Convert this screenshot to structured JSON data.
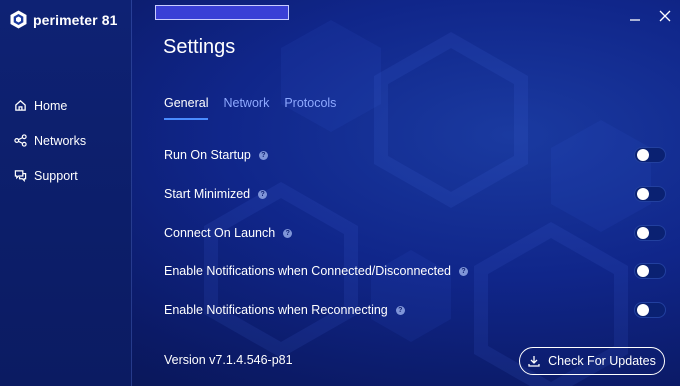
{
  "app": {
    "name": "perimeter 81"
  },
  "sidebar": {
    "items": [
      {
        "label": "Home",
        "icon": "home-icon"
      },
      {
        "label": "Networks",
        "icon": "share-nodes-icon"
      },
      {
        "label": "Support",
        "icon": "chat-icon"
      }
    ]
  },
  "window": {
    "minimize_icon": "minimize-icon",
    "close_icon": "close-icon"
  },
  "page": {
    "title": "Settings"
  },
  "tabs": [
    {
      "label": "General",
      "active": true
    },
    {
      "label": "Network",
      "active": false
    },
    {
      "label": "Protocols",
      "active": false
    }
  ],
  "settings": [
    {
      "label": "Run On Startup",
      "enabled": false
    },
    {
      "label": "Start Minimized",
      "enabled": false
    },
    {
      "label": "Connect On Launch",
      "enabled": false
    },
    {
      "label": "Enable Notifications when Connected/Disconnected",
      "enabled": false
    },
    {
      "label": "Enable Notifications when Reconnecting",
      "enabled": false
    }
  ],
  "help_glyph": "?",
  "footer": {
    "version": "Version v7.1.4.546-p81",
    "update_button": "Check For Updates"
  },
  "colors": {
    "accent": "#4a8cff",
    "tab_inactive": "#8ea9ff",
    "background": "#10268a",
    "redaction": "#3a3fd6"
  }
}
